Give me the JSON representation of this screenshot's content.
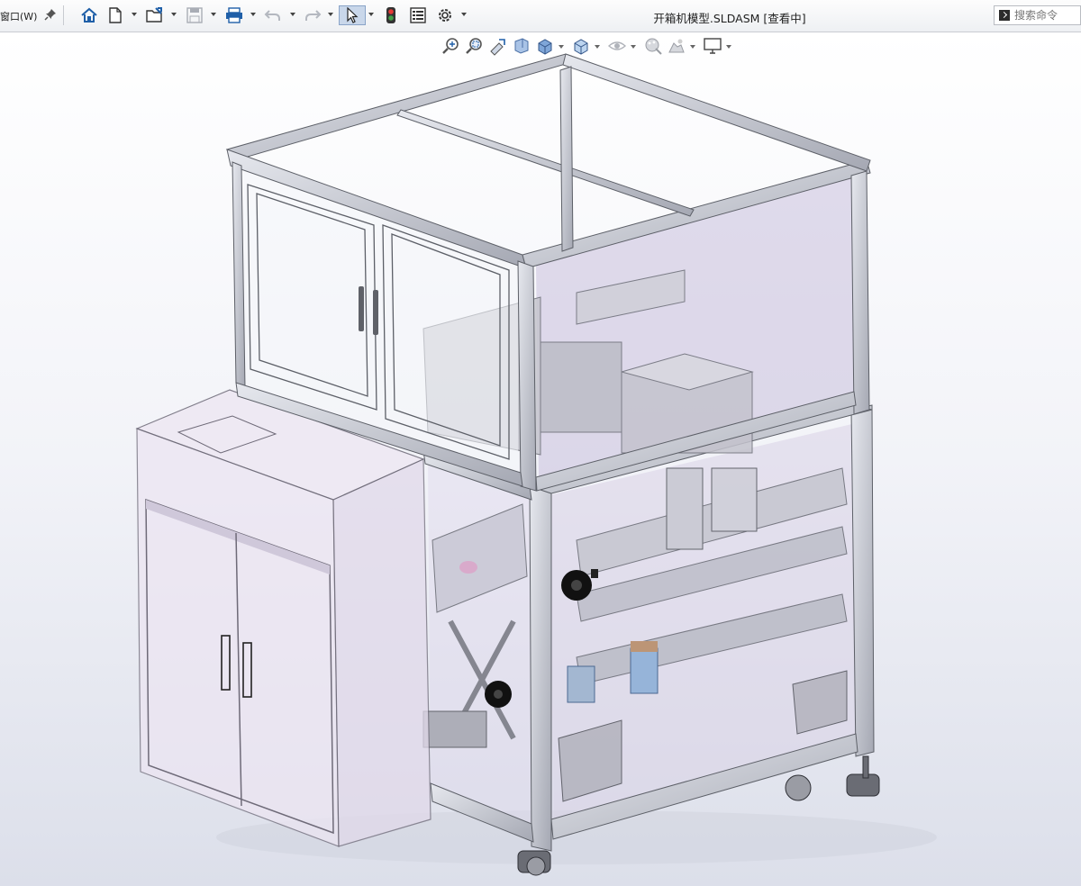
{
  "menu": {
    "window_label": "窗口(W)"
  },
  "document": {
    "title": "开箱机模型.SLDASM [查看中]"
  },
  "search": {
    "placeholder": "搜索命令"
  },
  "toolbar": {
    "icons": [
      "home-icon",
      "new-document-icon",
      "open-folder-icon",
      "save-icon",
      "print-icon",
      "undo-icon",
      "redo-icon",
      "select-pointer-icon",
      "rebuild-traffic-light-icon",
      "file-properties-icon",
      "options-gear-icon"
    ]
  },
  "heads_up_toolbar": {
    "icons": [
      "zoom-to-fit-icon",
      "zoom-to-area-icon",
      "previous-view-icon",
      "section-view-icon",
      "view-orientation-icon",
      "display-style-icon",
      "hide-show-items-icon",
      "edit-appearance-icon",
      "apply-scene-icon",
      "view-settings-icon"
    ]
  },
  "colors": {
    "frame_metal": "#c9ccd4",
    "glass_tint": "#c9bfdc",
    "background_top": "#ffffff",
    "background_bottom": "#dcdfea"
  }
}
